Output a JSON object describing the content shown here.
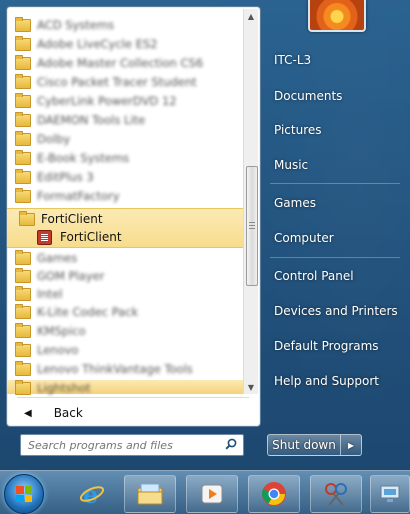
{
  "left_pane": {
    "programs_blurred": [
      {
        "label": "ACD Systems"
      },
      {
        "label": "Adobe LiveCycle ES2"
      },
      {
        "label": "Adobe Master Collection CS6"
      },
      {
        "label": "Cisco Packet Tracer Student"
      },
      {
        "label": "CyberLink PowerDVD 12"
      },
      {
        "label": "DAEMON Tools Lite"
      },
      {
        "label": "Dolby"
      },
      {
        "label": "E-Book Systems"
      },
      {
        "label": "EditPlus 3"
      },
      {
        "label": "FormatFactory"
      }
    ],
    "forti_folder": "FortiClient",
    "forti_app": "FortiClient",
    "programs_blurred_after": [
      {
        "label": "Games"
      },
      {
        "label": "GOM Player"
      },
      {
        "label": "Intel"
      },
      {
        "label": "K-Lite Codec Pack"
      },
      {
        "label": "KMSpico"
      },
      {
        "label": "Lenovo"
      },
      {
        "label": "Lenovo ThinkVantage Tools"
      },
      {
        "label": "Lightshot"
      }
    ],
    "back_label": "Back",
    "search_placeholder": "Search programs and files"
  },
  "right_pane": {
    "items": [
      {
        "label": "ITC-L3"
      },
      {
        "label": "Documents"
      },
      {
        "label": "Pictures"
      },
      {
        "label": "Music"
      },
      {
        "label": "Games"
      },
      {
        "label": "Computer"
      },
      {
        "label": "Control Panel"
      },
      {
        "label": "Devices and Printers"
      },
      {
        "label": "Default Programs"
      },
      {
        "label": "Help and Support"
      }
    ],
    "shutdown_label": "Shut down"
  },
  "taskbar": {
    "icons": [
      "start-orb-icon",
      "internet-explorer-icon",
      "file-explorer-icon",
      "media-player-icon",
      "chrome-icon",
      "snipping-tool-icon",
      "network-icon"
    ]
  },
  "colors": {
    "highlight": "#f7dc8c",
    "start_menu_blue": "#285f8c"
  }
}
